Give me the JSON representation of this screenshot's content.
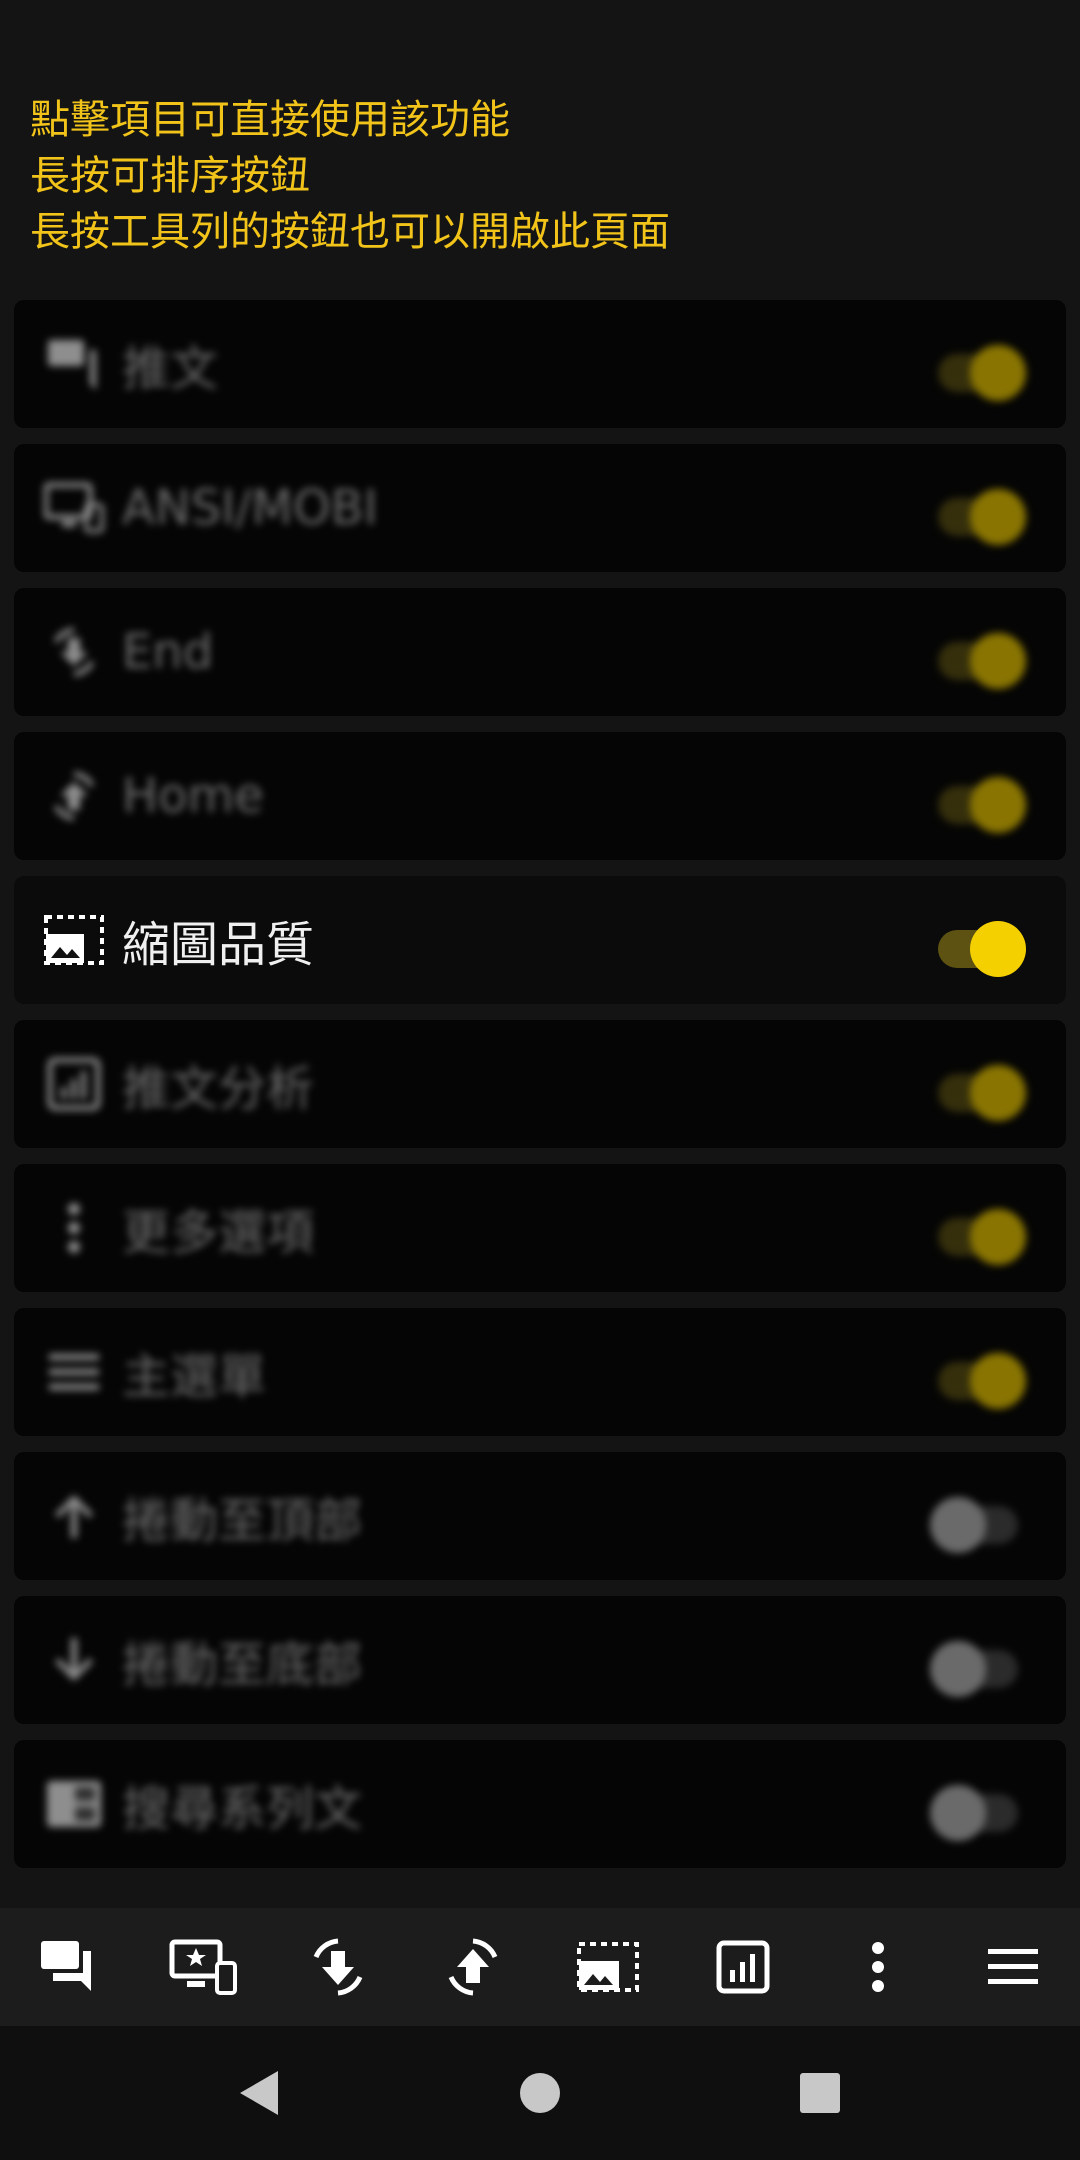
{
  "hint_lines": [
    "點擊項目可直接使用該功能",
    "長按可排序按鈕",
    "長按工具列的按鈕也可以開啟此頁面"
  ],
  "items": [
    {
      "label": "推文",
      "icon": "comments-icon",
      "enabled": true
    },
    {
      "label": "ANSI/MOBI",
      "icon": "devices-icon",
      "enabled": true
    },
    {
      "label": "End",
      "icon": "rotate-down-icon",
      "enabled": true
    },
    {
      "label": "Home",
      "icon": "rotate-up-icon",
      "enabled": true
    },
    {
      "label": "縮圖品質",
      "icon": "image-quality-icon",
      "enabled": true
    },
    {
      "label": "推文分析",
      "icon": "analytics-icon",
      "enabled": true
    },
    {
      "label": "更多選項",
      "icon": "more-vert-icon",
      "enabled": true
    },
    {
      "label": "主選單",
      "icon": "menu-icon",
      "enabled": true
    },
    {
      "label": "捲動至頂部",
      "icon": "arrow-up-icon",
      "enabled": false
    },
    {
      "label": "捲動至底部",
      "icon": "arrow-down-icon",
      "enabled": false
    },
    {
      "label": "搜尋系列文",
      "icon": "series-search-icon",
      "enabled": false
    }
  ],
  "toolbar_icons": [
    "comments-icon",
    "devices-icon",
    "rotate-down-icon",
    "rotate-up-icon",
    "image-quality-icon",
    "analytics-icon",
    "more-vert-icon",
    "menu-icon"
  ],
  "colors": {
    "accent": "#f5d000",
    "hint_text": "#f2c41a",
    "background": "#141414"
  }
}
